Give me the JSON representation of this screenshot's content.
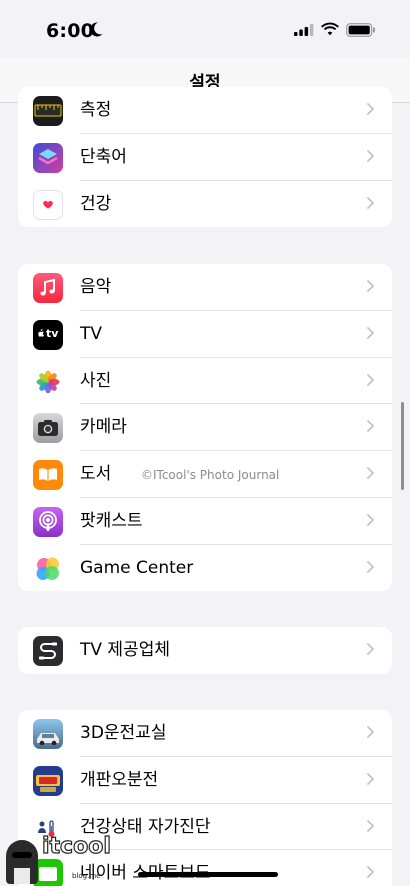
{
  "status_bar": {
    "time": "6:00"
  },
  "nav": {
    "title": "설정"
  },
  "groups": [
    {
      "items": [
        {
          "label": "측정",
          "icon": "measure-icon"
        },
        {
          "label": "단축어",
          "icon": "shortcuts-icon"
        },
        {
          "label": "건강",
          "icon": "health-icon"
        }
      ]
    },
    {
      "items": [
        {
          "label": "음악",
          "icon": "music-icon"
        },
        {
          "label": "TV",
          "icon": "apple-tv-icon"
        },
        {
          "label": "사진",
          "icon": "photos-icon"
        },
        {
          "label": "카메라",
          "icon": "camera-icon"
        },
        {
          "label": "도서",
          "icon": "books-icon"
        },
        {
          "label": "팟캐스트",
          "icon": "podcasts-icon"
        },
        {
          "label": "Game Center",
          "icon": "game-center-icon"
        }
      ]
    },
    {
      "items": [
        {
          "label": "TV 제공업체",
          "icon": "tv-provider-icon"
        }
      ]
    },
    {
      "items": [
        {
          "label": "3D운전교실",
          "icon": "3d-driving-app-icon"
        },
        {
          "label": "개판오분전",
          "icon": "gaepan-app-icon"
        },
        {
          "label": "건강상태 자가진단",
          "icon": "health-check-app-icon"
        },
        {
          "label": "네이버 스마트보드",
          "icon": "naver-smartboard-app-icon"
        }
      ]
    }
  ],
  "apple_tv_glyph": "tv",
  "watermark": "©ITcool's Photo Journal",
  "logo": {
    "text": "itcool",
    "sub": "blog.me"
  },
  "colors": {
    "background": "#f2f2f7",
    "row": "#ffffff",
    "chevron": "#c4c4c7",
    "music": "#fa3c58",
    "podcasts": "#a448db",
    "books": "#ff8a0a",
    "health_heart": "#ff2d55"
  }
}
